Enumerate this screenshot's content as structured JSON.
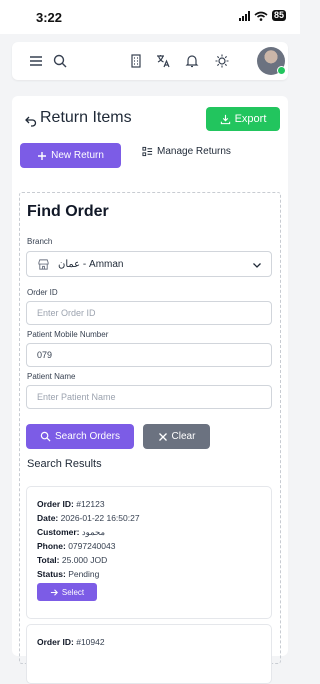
{
  "status_bar": {
    "time": "3:22",
    "battery": "85"
  },
  "topbar": {
    "icons": [
      "menu-icon",
      "search-icon",
      "building-icon",
      "translate-icon",
      "bell-icon",
      "sun-icon"
    ]
  },
  "page": {
    "title": "Return Items",
    "export_label": "Export",
    "new_return_label": "New Return",
    "manage_returns_label": "Manage Returns"
  },
  "find": {
    "title": "Find Order",
    "branch_label": "Branch",
    "branch_value": "عمان - Amman",
    "order_id_label": "Order ID",
    "order_id_placeholder": "Enter Order ID",
    "mobile_label": "Patient Mobile Number",
    "mobile_value": "079",
    "name_label": "Patient Name",
    "name_placeholder": "Enter Patient Name",
    "search_label": "Search Orders",
    "clear_label": "Clear"
  },
  "results": {
    "title": "Search Results",
    "field_labels": {
      "order_id": "Order ID:",
      "date": "Date:",
      "customer": "Customer:",
      "phone": "Phone:",
      "total": "Total:",
      "status": "Status:"
    },
    "select_label": "Select",
    "items": [
      {
        "order_id": "#12123",
        "date": "2026-01-22 16:50:27",
        "customer": "محمود",
        "phone": "0797240043",
        "total": "25.000 JOD",
        "status": "Pending"
      },
      {
        "order_id": "#10942"
      }
    ]
  },
  "colors": {
    "primary": "#7c5ce6",
    "success": "#22c55e",
    "neutral": "#6b7280"
  }
}
